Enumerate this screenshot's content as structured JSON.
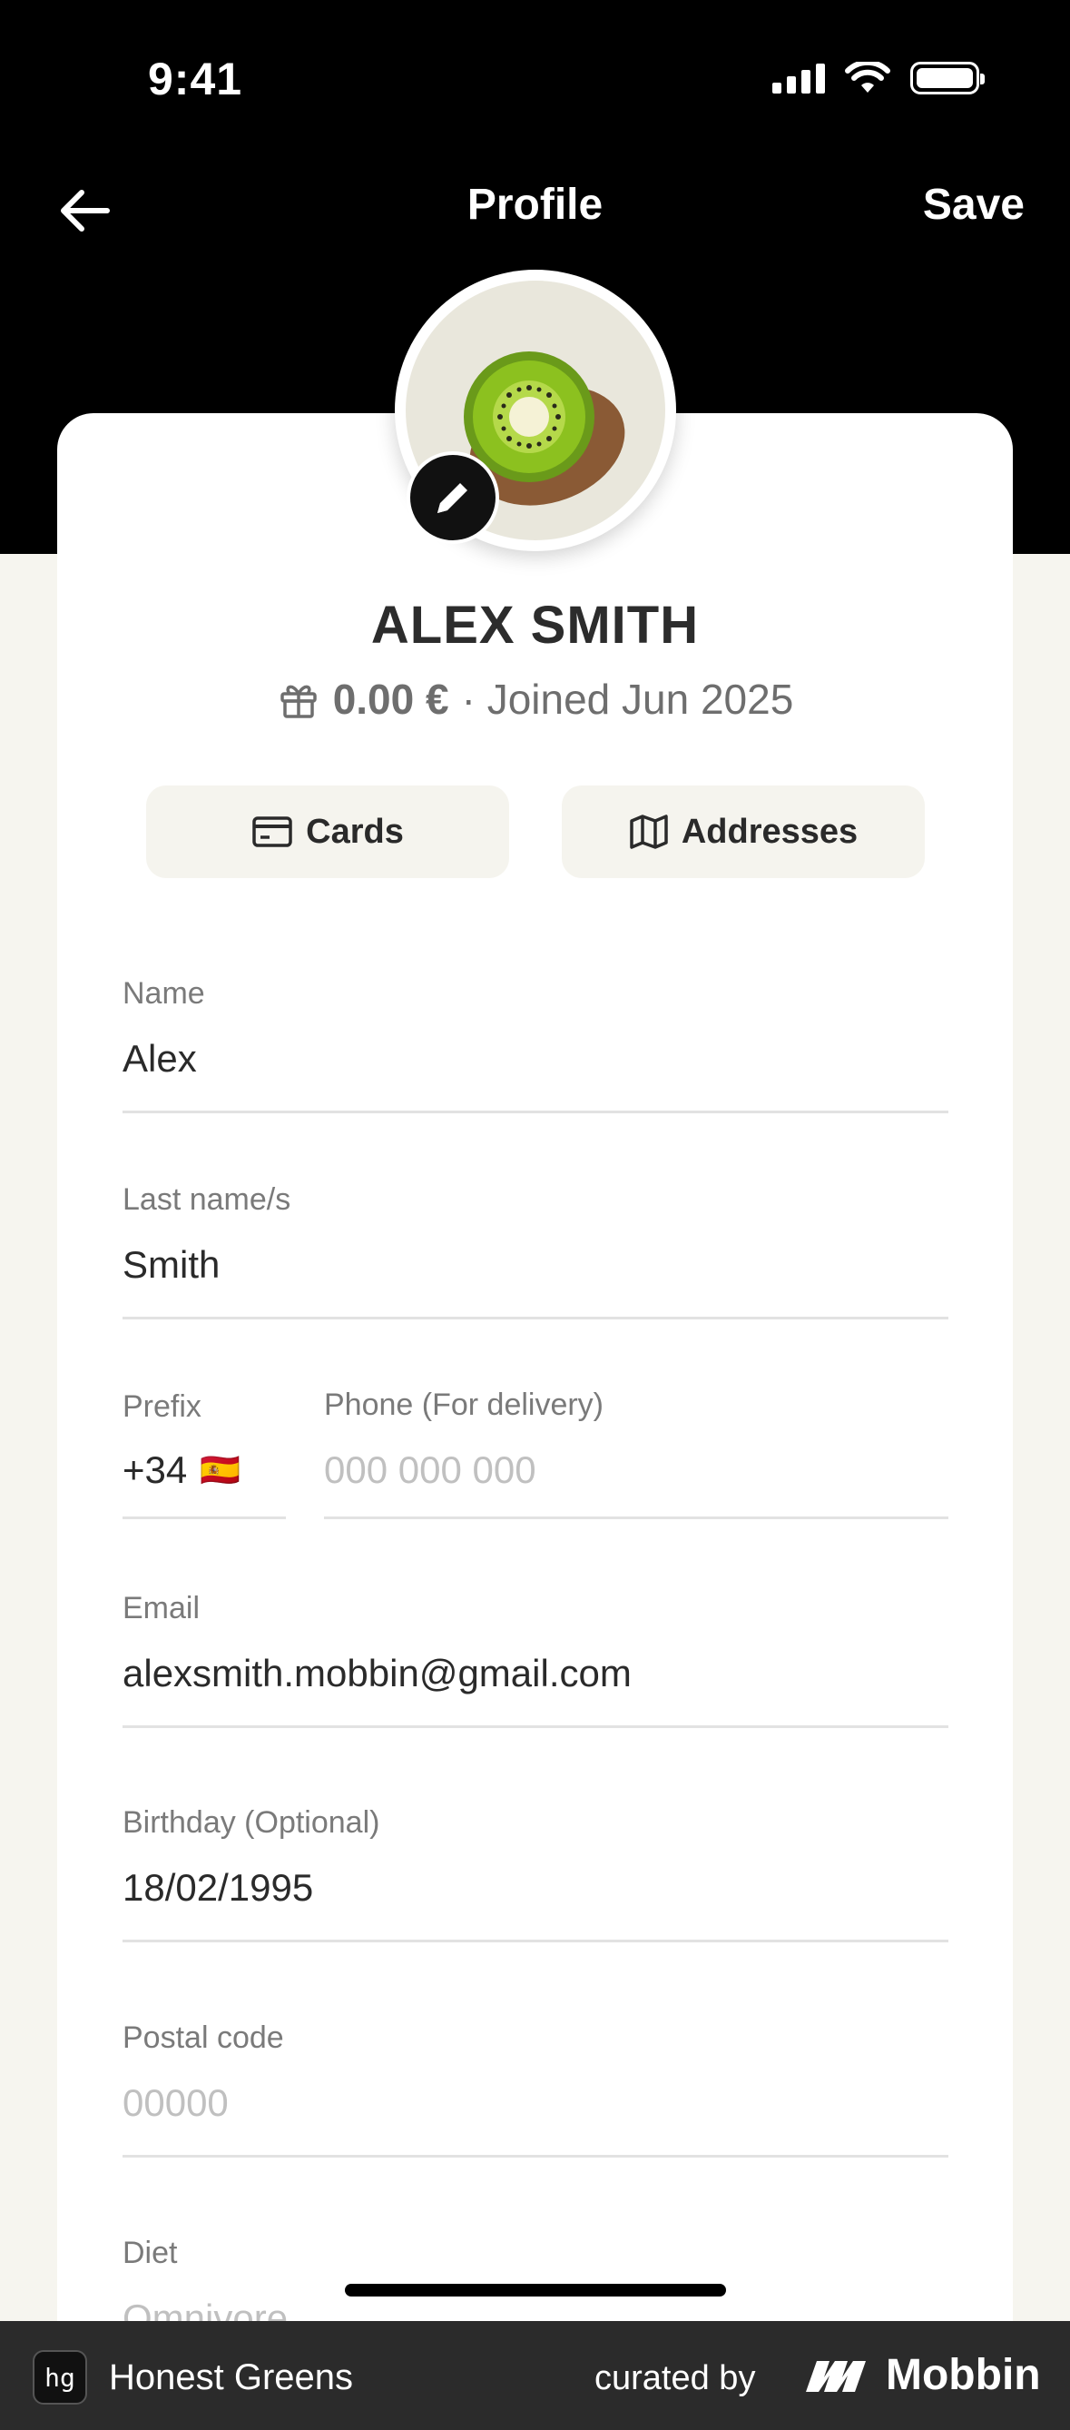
{
  "status_bar": {
    "time": "9:41"
  },
  "nav": {
    "title": "Profile",
    "save_label": "Save"
  },
  "profile": {
    "name": "ALEX SMITH",
    "balance": "0.00 €",
    "joined": "· Joined Jun 2025"
  },
  "buttons": {
    "cards_label": "Cards",
    "addresses_label": "Addresses"
  },
  "fields": {
    "name": {
      "label": "Name",
      "value": "Alex"
    },
    "last_name": {
      "label": "Last name/s",
      "value": "Smith"
    },
    "prefix": {
      "label": "Prefix",
      "value": "+34",
      "flag": "🇪🇸"
    },
    "phone": {
      "label": "Phone (For delivery)",
      "placeholder": "000 000 000"
    },
    "email": {
      "label": "Email",
      "value": "alexsmith.mobbin@gmail.com"
    },
    "birthday": {
      "label": "Birthday (Optional)",
      "value": "18/02/1995"
    },
    "postal_code": {
      "label": "Postal code",
      "placeholder": "00000"
    },
    "diet": {
      "label": "Diet",
      "placeholder": "Omnivore"
    }
  },
  "footer": {
    "app_icon_text": "hg",
    "app_name": "Honest Greens",
    "curated_by": "curated by",
    "brand": "Mobbin"
  },
  "colors": {
    "header": "#000000",
    "page_bg": "#f6f5ef",
    "card_bg": "#ffffff",
    "pill_bg": "#f5f4ee",
    "footer_bg": "#2b2b2b"
  },
  "icons": [
    "back-arrow-icon",
    "pencil-icon",
    "gift-icon",
    "credit-card-icon",
    "map-icon",
    "signal-icon",
    "wifi-icon",
    "battery-icon"
  ]
}
